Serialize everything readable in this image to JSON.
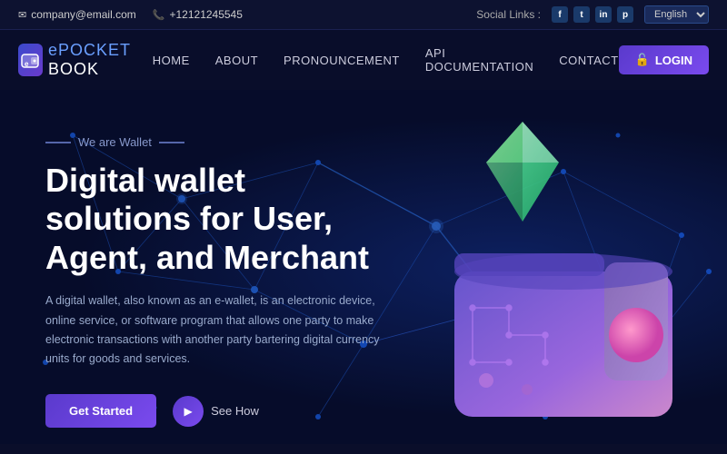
{
  "topbar": {
    "email": "company@email.com",
    "phone": "+12121245545",
    "social_label": "Social Links :",
    "social_icons": [
      "f",
      "t",
      "in",
      "p"
    ],
    "lang_default": "English"
  },
  "navbar": {
    "logo_text_bold": "POCKET",
    "logo_text_light": "BOOK",
    "logo_prefix": "e",
    "nav_items": [
      {
        "label": "HOME",
        "id": "home"
      },
      {
        "label": "ABOUT",
        "id": "about"
      },
      {
        "label": "PRONOUNCEMENT",
        "id": "pronouncement"
      },
      {
        "label": "API DOCUMENTATION",
        "id": "api-docs"
      },
      {
        "label": "CONTACT",
        "id": "contact"
      }
    ],
    "login_label": "LOGIN"
  },
  "hero": {
    "we_are_label": "We are Wallet",
    "title_line1": "Digital wallet",
    "title_line2": "solutions for User,",
    "title_line3": "Agent, and Merchant",
    "description": "A digital wallet, also known as an e-wallet, is an electronic device, online service, or software program that allows one party to make electronic transactions with another party bartering digital currency units for goods and services.",
    "cta_primary": "Get Started",
    "cta_secondary": "See How"
  }
}
